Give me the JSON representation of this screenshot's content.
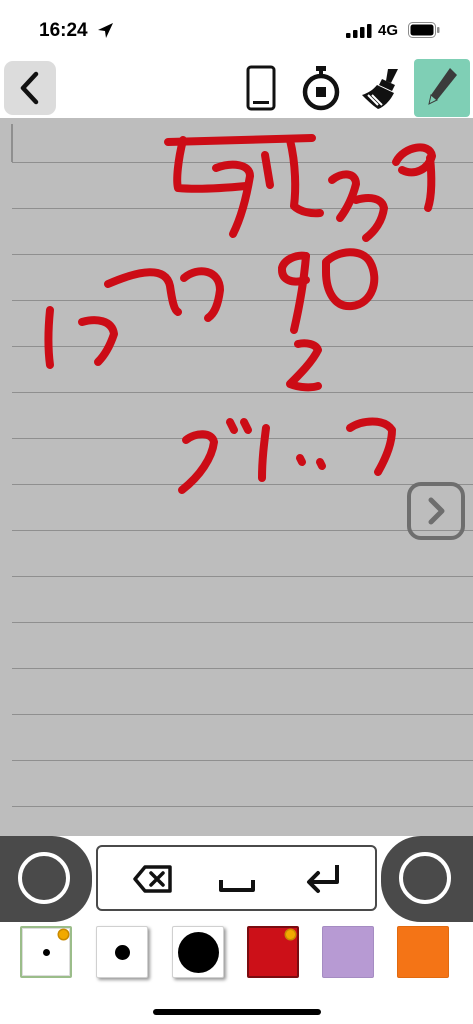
{
  "status_bar": {
    "time": "16:24",
    "network": "4G",
    "icons": [
      "location-arrow-icon",
      "signal-bars-icon",
      "battery-icon"
    ]
  },
  "toolbar": {
    "back_icon": "chevron-left-icon",
    "tools": [
      "phone-icon",
      "stopwatch-icon",
      "broom-icon",
      "pencil-icon"
    ],
    "active_tool": "pencil-icon",
    "active_color": "#7fcfb5"
  },
  "canvas": {
    "paper_color": "#bdbdbd",
    "rule_color": "#8f8f8f",
    "ink_color": "#cc0c16",
    "next_page_icon": "chevron-right-icon"
  },
  "keys": {
    "backspace_icon": "backspace-icon",
    "space_icon": "space-bar-icon",
    "enter_icon": "return-arrow-icon"
  },
  "brushes": [
    {
      "name": "small-dot",
      "color": "#000000",
      "selected": true
    },
    {
      "name": "medium-dot",
      "color": "#000000",
      "selected": false
    },
    {
      "name": "large-dot",
      "color": "#000000",
      "selected": false
    }
  ],
  "colors": [
    {
      "name": "red",
      "hex": "#cc1018",
      "selected": true
    },
    {
      "name": "lavender",
      "hex": "#b79ad3",
      "selected": false
    },
    {
      "name": "orange",
      "hex": "#f47416",
      "selected": false
    }
  ]
}
